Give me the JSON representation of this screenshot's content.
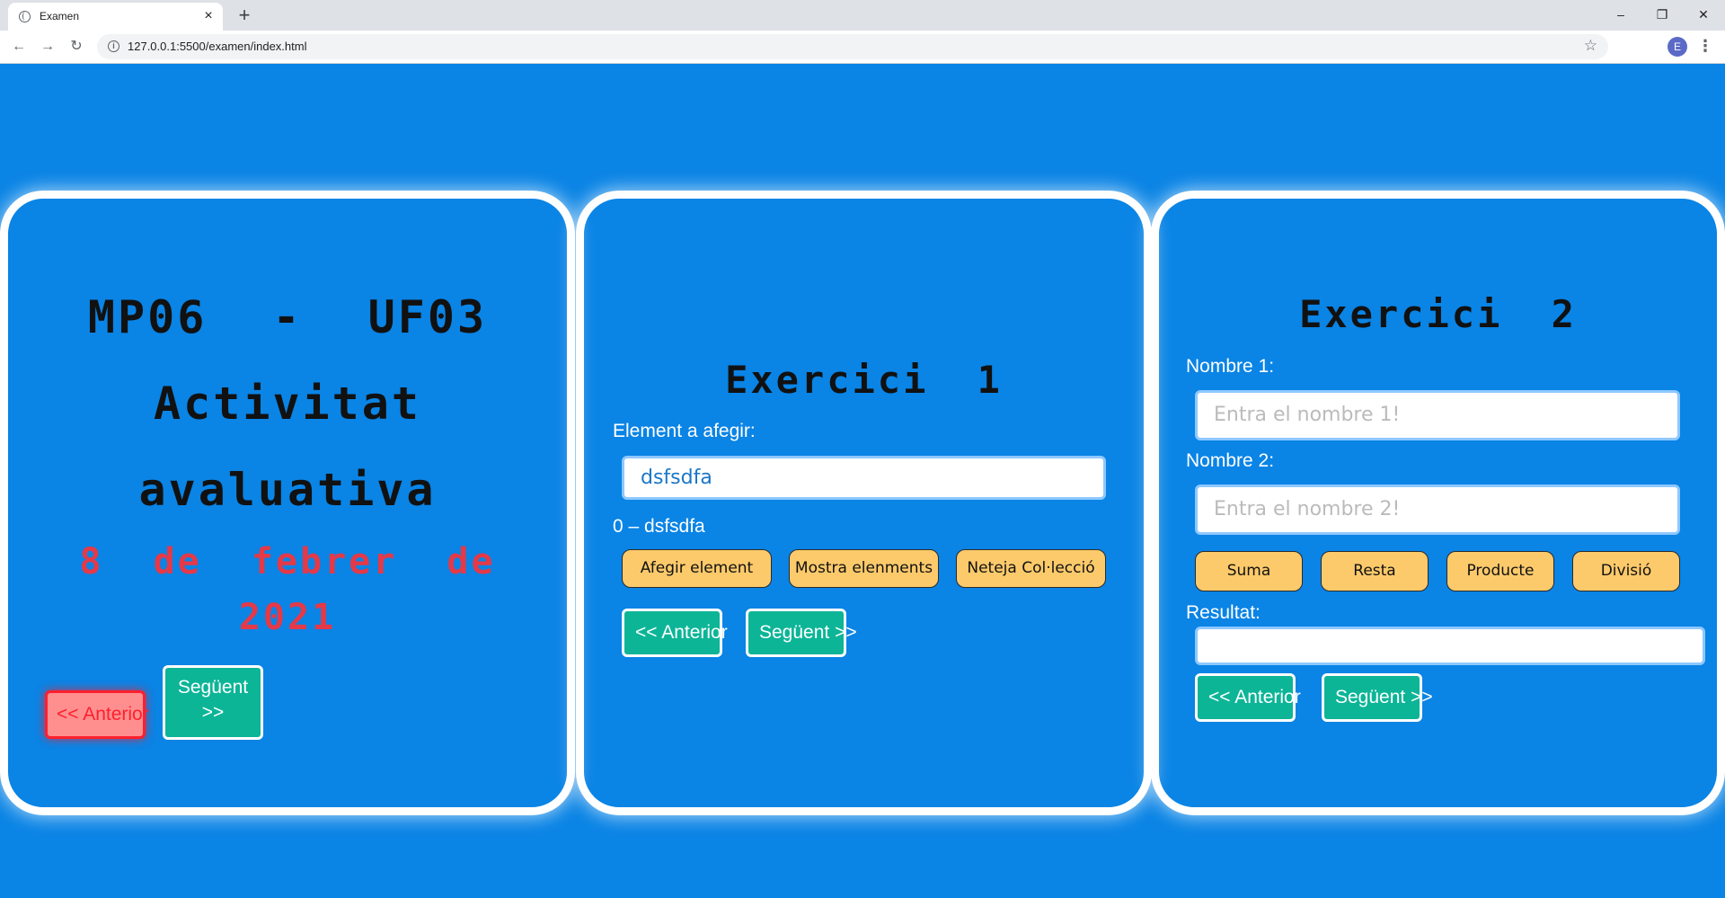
{
  "browser": {
    "tab_title": "Examen",
    "tab_close": "×",
    "new_tab": "+",
    "url": "127.0.0.1:5500/examen/index.html",
    "profile_initial": "E",
    "minimize": "–",
    "restore": "❐",
    "close": "✕",
    "back": "←",
    "forward": "→",
    "reload": "↻",
    "star": "☆",
    "menu": "⋮",
    "info": "i"
  },
  "panel1": {
    "title_line1_a": "MP06",
    "title_line1_b": "-",
    "title_line1_c": "UF03",
    "title_line2": "Activitat",
    "title_line3": "avaluativa",
    "date_line1": "8 de febrer de",
    "date_line2": "2021",
    "prev_label": "<< Anterior",
    "next_label_line1": "Següent",
    "next_label_line2": ">>"
  },
  "panel2": {
    "title": "Exercici 1",
    "element_label": "Element a afegir:",
    "element_value": "dsfsdfa",
    "list_item": "0 – dsfsdfa",
    "buttons": [
      "Afegir element",
      "Mostra elenments",
      "Neteja Col·lecció"
    ],
    "prev_label": "<< Anterior",
    "next_label": "Següent >>"
  },
  "panel3": {
    "title": "Exercici 2",
    "number1_label": "Nombre 1:",
    "number1_placeholder": "Entra el nombre 1!",
    "number2_label": "Nombre 2:",
    "number2_placeholder": "Entra el nombre 2!",
    "buttons": [
      "Suma",
      "Resta",
      "Producte",
      "Divisió"
    ],
    "result_label": "Resultat:",
    "prev_label": "<< Anterior",
    "next_label": "Següent >>"
  },
  "colors": {
    "page_bg": "#0a84e5",
    "accent_green": "#0db597",
    "warning_red": "#ff1f2e",
    "button_yellow": "#fdca6b",
    "date_red": "#e53948"
  }
}
